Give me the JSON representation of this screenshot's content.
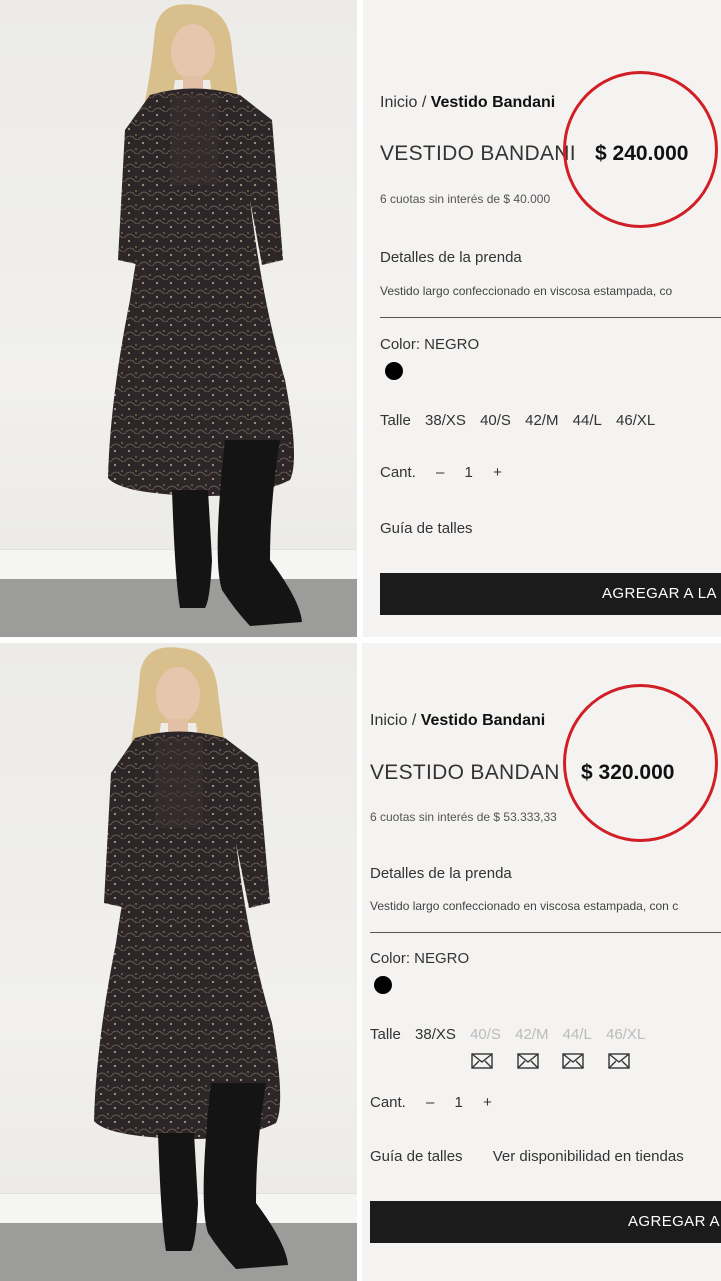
{
  "top": {
    "breadcrumb_home": "Inicio",
    "breadcrumb_sep": "/",
    "breadcrumb_current": "Vestido Bandani",
    "title": "VESTIDO BANDANI",
    "price": "$ 240.000",
    "installments": "6 cuotas sin interés de $ 40.000",
    "details_heading": "Detalles de la prenda",
    "details_text": "Vestido largo confeccionado en viscosa estampada, co",
    "color_label": "Color: NEGRO",
    "size_label": "Talle",
    "sizes": [
      "38/XS",
      "40/S",
      "42/M",
      "44/L",
      "46/XL"
    ],
    "qty_label": "Cant.",
    "qty_minus": "–",
    "qty_value": "1",
    "qty_plus": "+",
    "size_guide": "Guía de talles",
    "cta": "AGREGAR A LA"
  },
  "bottom": {
    "breadcrumb_home": "Inicio",
    "breadcrumb_sep": "/",
    "breadcrumb_current": "Vestido Bandani",
    "title": "VESTIDO BANDAN",
    "price": "$ 320.000",
    "installments": "6 cuotas sin interés de $ 53.333,33",
    "details_heading": "Detalles de la prenda",
    "details_text": "Vestido largo confeccionado en viscosa estampada, con c",
    "color_label": "Color: NEGRO",
    "size_label": "Talle",
    "sizes": [
      "38/XS",
      "40/S",
      "42/M",
      "44/L",
      "46/XL"
    ],
    "qty_label": "Cant.",
    "qty_minus": "–",
    "qty_value": "1",
    "qty_plus": "+",
    "size_guide": "Guía de talles",
    "store_availability": "Ver disponibilidad en tiendas",
    "cta": "AGREGAR A"
  },
  "colors": {
    "highlight_circle": "#d21f26",
    "cta_background": "#1b1b1b",
    "swatch": "#000000",
    "panel_background": "#f4f3f1"
  },
  "icons": {
    "notify": "envelope-icon"
  }
}
